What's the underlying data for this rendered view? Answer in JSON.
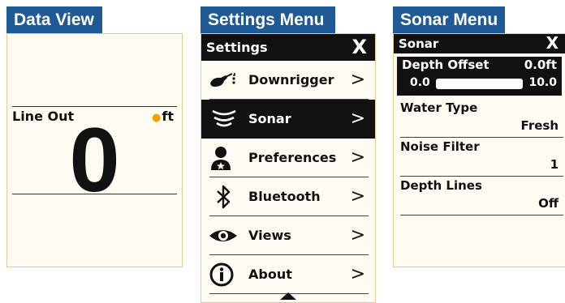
{
  "data_view": {
    "tag": "Data View",
    "line_out_label": "Line Out",
    "unit": "ft",
    "value": "0"
  },
  "settings_menu": {
    "tag": "Settings Menu",
    "header": "Settings",
    "close": "X",
    "items": [
      {
        "label": "Downrigger",
        "icon": "downrigger-icon",
        "selected": false
      },
      {
        "label": "Sonar",
        "icon": "sonar-icon",
        "selected": true
      },
      {
        "label": "Preferences",
        "icon": "preferences-icon",
        "selected": false
      },
      {
        "label": "Bluetooth",
        "icon": "bluetooth-icon",
        "selected": false
      },
      {
        "label": "Views",
        "icon": "eye-icon",
        "selected": false
      },
      {
        "label": "About",
        "icon": "info-icon",
        "selected": false
      }
    ],
    "chevron": ">"
  },
  "sonar_menu": {
    "tag": "Sonar Menu",
    "header": "Sonar",
    "close": "X",
    "depth_offset": {
      "label": "Depth Offset",
      "value": "0.0ft",
      "min": "0.0",
      "max": "10.0"
    },
    "items": [
      {
        "label": "Water Type",
        "value": "Fresh"
      },
      {
        "label": "Noise Filter",
        "value": "1"
      },
      {
        "label": "Depth Lines",
        "value": "Off"
      }
    ]
  },
  "colors": {
    "accent": "#1f5a96",
    "screen_bg": "#fffbf2",
    "border": "#e8c98e",
    "highlight": "#f0a000"
  }
}
